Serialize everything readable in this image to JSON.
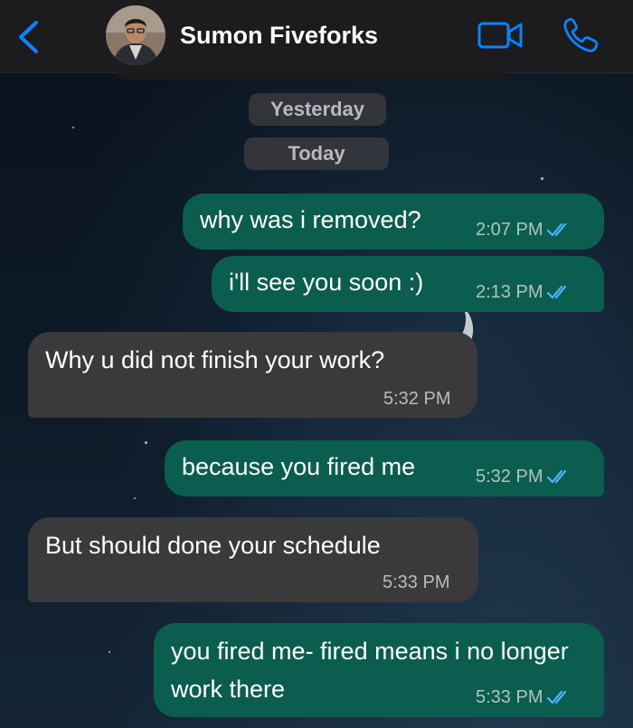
{
  "header": {
    "contact_name": "Sumon Fiveforks",
    "back_icon": "chevron-left-icon",
    "video_icon": "video-camera-icon",
    "call_icon": "phone-icon",
    "accent_color": "#0a84ff"
  },
  "date_separators": [
    "Yesterday",
    "Today"
  ],
  "messages": [
    {
      "direction": "outgoing",
      "text": "why was i removed?",
      "time": "2:07 PM",
      "status": "read"
    },
    {
      "direction": "outgoing",
      "text": "i'll see you soon :)",
      "time": "2:13 PM",
      "status": "read"
    },
    {
      "direction": "incoming",
      "text": "Why u did not finish your work?",
      "time": "5:32 PM"
    },
    {
      "direction": "outgoing",
      "text": "because you fired me",
      "time": "5:32 PM",
      "status": "read"
    },
    {
      "direction": "incoming",
      "text": "But should done your schedule",
      "time": "5:33 PM"
    },
    {
      "direction": "outgoing",
      "text": "you fired me- fired means i no longer work there",
      "time": "5:33 PM",
      "status": "read"
    }
  ],
  "colors": {
    "outgoing_bubble": "#0b5d4f",
    "incoming_bubble": "#3a3a3c",
    "read_ticks": "#4fb3ff"
  }
}
